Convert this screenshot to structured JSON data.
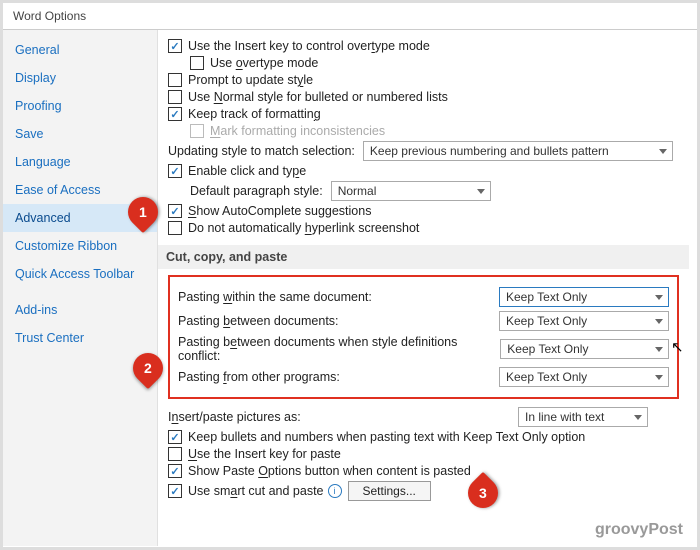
{
  "title": "Word Options",
  "sidebar": {
    "items": [
      {
        "label": "General"
      },
      {
        "label": "Display"
      },
      {
        "label": "Proofing"
      },
      {
        "label": "Save"
      },
      {
        "label": "Language"
      },
      {
        "label": "Ease of Access"
      },
      {
        "label": "Advanced",
        "selected": true
      },
      {
        "label": "Customize Ribbon"
      },
      {
        "label": "Quick Access Toolbar"
      },
      {
        "label": "Add-ins"
      },
      {
        "label": "Trust Center"
      }
    ]
  },
  "editing": {
    "use_insert_key": {
      "label_pre": "Use the Insert key to control over",
      "u": "t",
      "label_post": "ype mode",
      "checked": true
    },
    "use_overtype": {
      "label_pre": "Use ",
      "u": "o",
      "label_post": "vertype mode",
      "checked": false
    },
    "prompt_update": {
      "label_pre": "Prompt to update st",
      "u": "y",
      "label_post": "le",
      "checked": false
    },
    "normal_bulleted": {
      "label_pre": "Use ",
      "u": "N",
      "label_post": "ormal style for bulleted or numbered lists",
      "checked": false
    },
    "keep_track": {
      "label_pre": "Keep track of formattin",
      "u": "g",
      "label_post": "",
      "checked": true
    },
    "mark_inconsistencies": {
      "label_pre": "",
      "u": "M",
      "label_post": "ark formatting inconsistencies",
      "checked": false,
      "disabled": true
    },
    "updating_style_label": "Updating style to match selection:",
    "updating_style_value": "Keep previous numbering and bullets pattern",
    "enable_click_type": {
      "label_pre": "Enable click and ty",
      "u": "p",
      "label_post": "e",
      "checked": true
    },
    "default_style_label": "Default paragraph style:",
    "default_style_value": "Normal",
    "autocomplete": {
      "label_pre": "",
      "u": "S",
      "label_post": "how AutoComplete suggestions",
      "checked": true
    },
    "no_hyperlink": {
      "label_pre": "Do not automatically ",
      "u": "h",
      "label_post": "yperlink screenshot",
      "checked": false
    }
  },
  "paste": {
    "section": "Cut, copy, and paste",
    "rows": [
      {
        "label_pre": "Pasting ",
        "u": "w",
        "label_post": "ithin the same document:",
        "value": "Keep Text Only"
      },
      {
        "label_pre": "Pasting ",
        "u": "b",
        "label_post": "etween documents:",
        "value": "Keep Text Only"
      },
      {
        "label_pre": "Pasting b",
        "u": "e",
        "label_post": "tween documents when style definitions conflict:",
        "value": "Keep Text Only"
      },
      {
        "label_pre": "Pasting ",
        "u": "f",
        "label_post": "rom other programs:",
        "value": "Keep Text Only"
      }
    ],
    "insert_pictures_label": "Insert/paste pictures as:",
    "insert_pictures_value": "In line with text",
    "keep_bullets": {
      "label_pre": "Keep bullets and numbers when pasting text with Keep Text Only option",
      "checked": true
    },
    "insert_key_paste": {
      "label_pre": "",
      "u": "U",
      "label_post": "se the Insert key for paste",
      "checked": false
    },
    "paste_options": {
      "label_pre": "Show Paste ",
      "u": "O",
      "label_post": "ptions button when content is pasted",
      "checked": true
    },
    "smart_cut": {
      "label_pre": "Use sm",
      "u": "a",
      "label_post": "rt cut and paste",
      "checked": true
    },
    "settings_button": "Settings..."
  },
  "callouts": {
    "c1": "1",
    "c2": "2",
    "c3": "3"
  },
  "watermark": "groovyPost"
}
